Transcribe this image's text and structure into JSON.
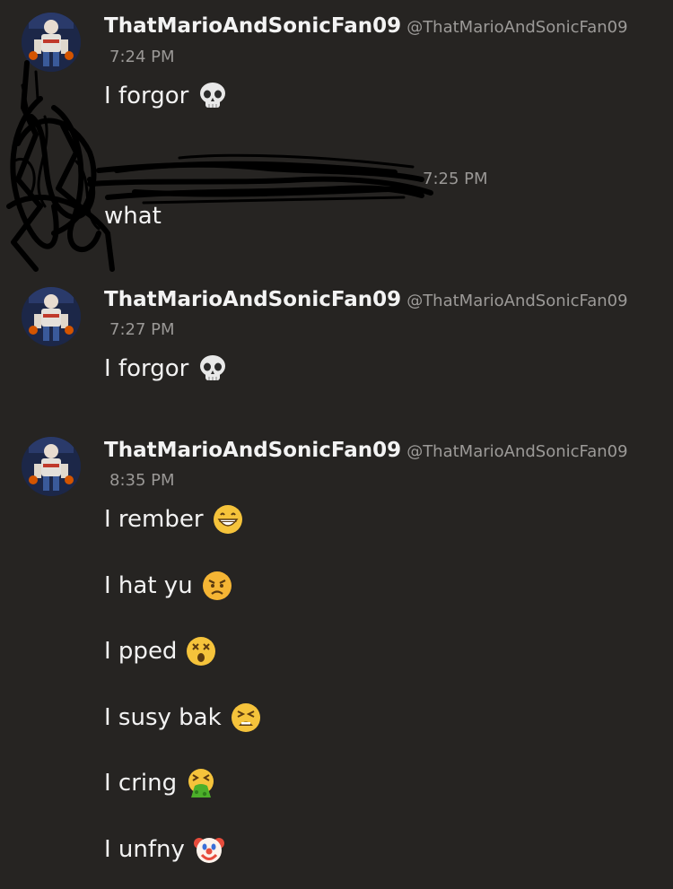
{
  "messages": [
    {
      "username": "ThatMarioAndSonicFan09",
      "handle": "@ThatMarioAndSonicFan09",
      "time": "7:24 PM",
      "lines": [
        {
          "text": "I forgor",
          "emoji": "skull"
        }
      ]
    },
    {
      "username": "",
      "handle": "",
      "time": "7:25 PM",
      "redacted": true,
      "lines": [
        {
          "text": "what",
          "emoji": ""
        }
      ]
    },
    {
      "username": "ThatMarioAndSonicFan09",
      "handle": "@ThatMarioAndSonicFan09",
      "time": "7:27 PM",
      "lines": [
        {
          "text": "I forgor",
          "emoji": "skull"
        }
      ]
    },
    {
      "username": "ThatMarioAndSonicFan09",
      "handle": "@ThatMarioAndSonicFan09",
      "time": "8:35 PM",
      "lines": [
        {
          "text": "I rember",
          "emoji": "grinning-face"
        },
        {
          "text": "I hat yu",
          "emoji": "angry-face"
        },
        {
          "text": "I pped",
          "emoji": "dizzy-face"
        },
        {
          "text": "I susy bak",
          "emoji": "tired-face"
        },
        {
          "text": "I cring",
          "emoji": "vomiting-face"
        },
        {
          "text": "I unfny",
          "emoji": "clown-face"
        }
      ]
    }
  ],
  "colors": {
    "background": "#262422",
    "username": "#f3f3f3",
    "meta": "#9a9896",
    "scribble": "#000000"
  }
}
